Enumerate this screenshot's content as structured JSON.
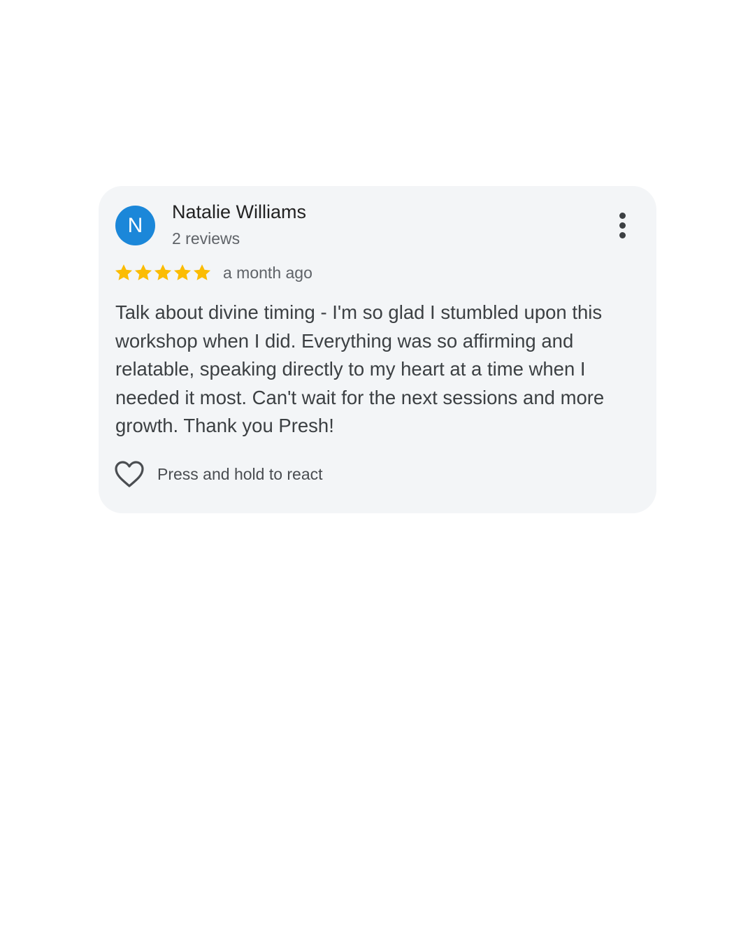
{
  "review": {
    "avatar_initial": "N",
    "reviewer_name": "Natalie Williams",
    "review_count": "2 reviews",
    "rating": 5,
    "rating_max": 5,
    "date": "a month ago",
    "text": "Talk about divine timing - I'm so glad I stumbled upon this workshop when I did. Everything was so affirming and relatable, speaking directly to my heart at a time when I needed it most. Can't wait for the next sessions and more growth. Thank you Presh!",
    "react_label": "Press and hold to react"
  },
  "icons": {
    "menu": "more-vert-icon",
    "star": "star-icon",
    "react": "heart-outline-icon"
  },
  "colors": {
    "avatar": "#1b87d9",
    "star": "#fbbc04",
    "card_background": "#f3f5f7"
  }
}
